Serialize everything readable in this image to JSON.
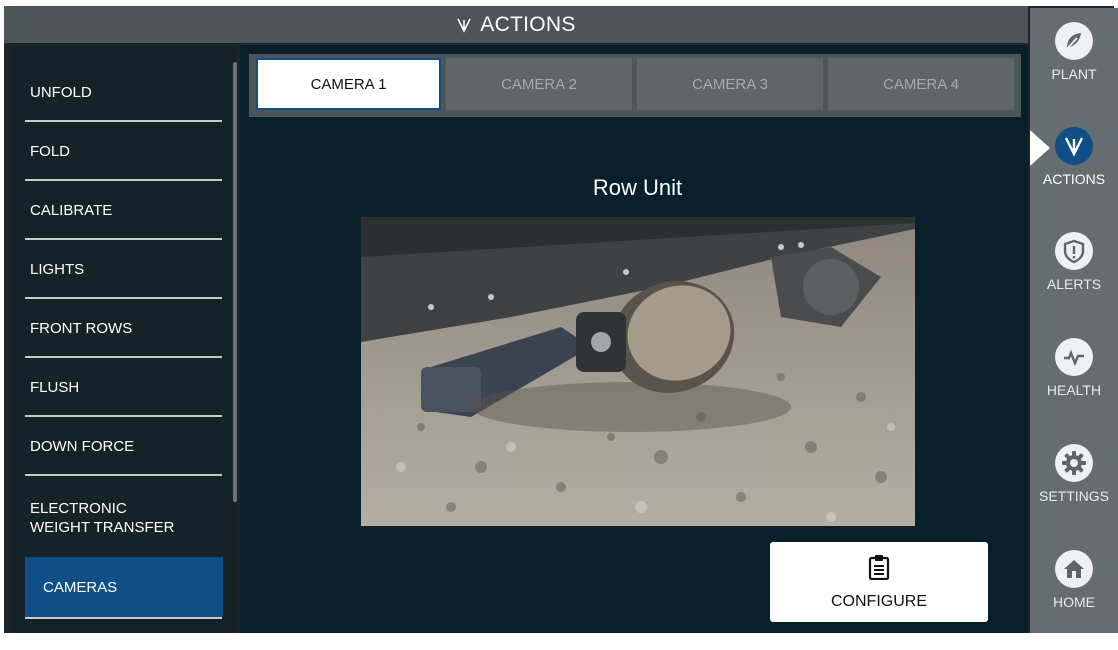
{
  "header": {
    "title": "ACTIONS",
    "icon": "actions-fork-icon"
  },
  "menu": {
    "items": [
      {
        "label": "UNFOLD"
      },
      {
        "label": "FOLD"
      },
      {
        "label": "CALIBRATE"
      },
      {
        "label": "LIGHTS"
      },
      {
        "label": "FRONT ROWS"
      },
      {
        "label": "FLUSH"
      },
      {
        "label": "DOWN FORCE"
      },
      {
        "label_line1": "ELECTRONIC",
        "label_line2": "WEIGHT TRANSFER"
      },
      {
        "label": "CAMERAS",
        "active": true
      }
    ]
  },
  "tabs": [
    {
      "label": "CAMERA 1",
      "active": true
    },
    {
      "label": "CAMERA 2"
    },
    {
      "label": "CAMERA 3"
    },
    {
      "label": "CAMERA 4"
    }
  ],
  "camera": {
    "title": "Row Unit"
  },
  "configure": {
    "label": "CONFIGURE",
    "icon": "clipboard-icon"
  },
  "rail": {
    "items": [
      {
        "label": "PLANT",
        "icon": "plant-icon"
      },
      {
        "label": "ACTIONS",
        "icon": "actions-fork-icon",
        "active": true
      },
      {
        "label": "ALERTS",
        "icon": "shield-alert-icon"
      },
      {
        "label": "HEALTH",
        "icon": "health-pulse-icon"
      },
      {
        "label": "SETTINGS",
        "icon": "gear-icon"
      },
      {
        "label": "HOME",
        "icon": "home-icon"
      }
    ]
  },
  "colors": {
    "accent": "#0f4f86",
    "background": "#09202a",
    "rail": "#656d70",
    "header": "#4d5558"
  }
}
